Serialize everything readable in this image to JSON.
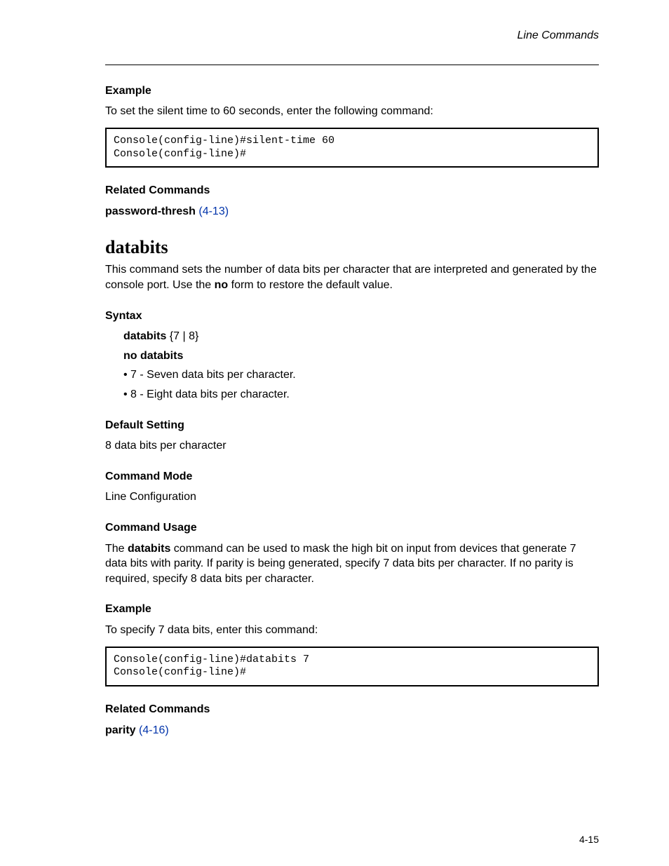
{
  "header": {
    "right_italic": "Line Commands"
  },
  "example1": {
    "title": "Example",
    "intro": "To set the silent time to 60 seconds, enter the following command:",
    "code": "Console(config-line)#silent-time 60\nConsole(config-line)#"
  },
  "related1": {
    "title": "Related Commands",
    "items": [
      {
        "cmd": "password-thresh",
        "page": "(4-13)"
      }
    ]
  },
  "databits": {
    "name": "databits",
    "desc": "This command sets the number of data bits per character that are interpreted and generated by the console port. Use the ",
    "desc_no": "no",
    "desc_tail": " form to restore the default value.",
    "syntax_title": "Syntax",
    "syntax_l1_pre": "databits",
    "syntax_l1_args": " {7 | 8}",
    "syntax_l2": "no databits",
    "arg7": "• 7 - Seven data bits per character.",
    "arg8": "• 8 - Eight data bits per character.",
    "default_title": "Default Setting",
    "default_body": "8 data bits per character",
    "mode_title": "Command Mode",
    "mode_body": "Line Configuration",
    "usage_title": "Command Usage",
    "usage_pre": "The ",
    "usage_cmd": "databits",
    "usage_post": " command can be used to mask the high bit on input from devices that generate 7 data bits with parity. If parity is being generated, specify 7 data bits per character. If no parity is required, specify 8 data bits per character.",
    "example_title": "Example",
    "example_intro": "To specify 7 data bits, enter this command:",
    "example_code": "Console(config-line)#databits 7\nConsole(config-line)#"
  },
  "related2": {
    "title": "Related Commands",
    "items": [
      {
        "cmd": "parity",
        "page": "(4-16)"
      }
    ]
  },
  "footer": {
    "left": "",
    "right": "4-15"
  }
}
